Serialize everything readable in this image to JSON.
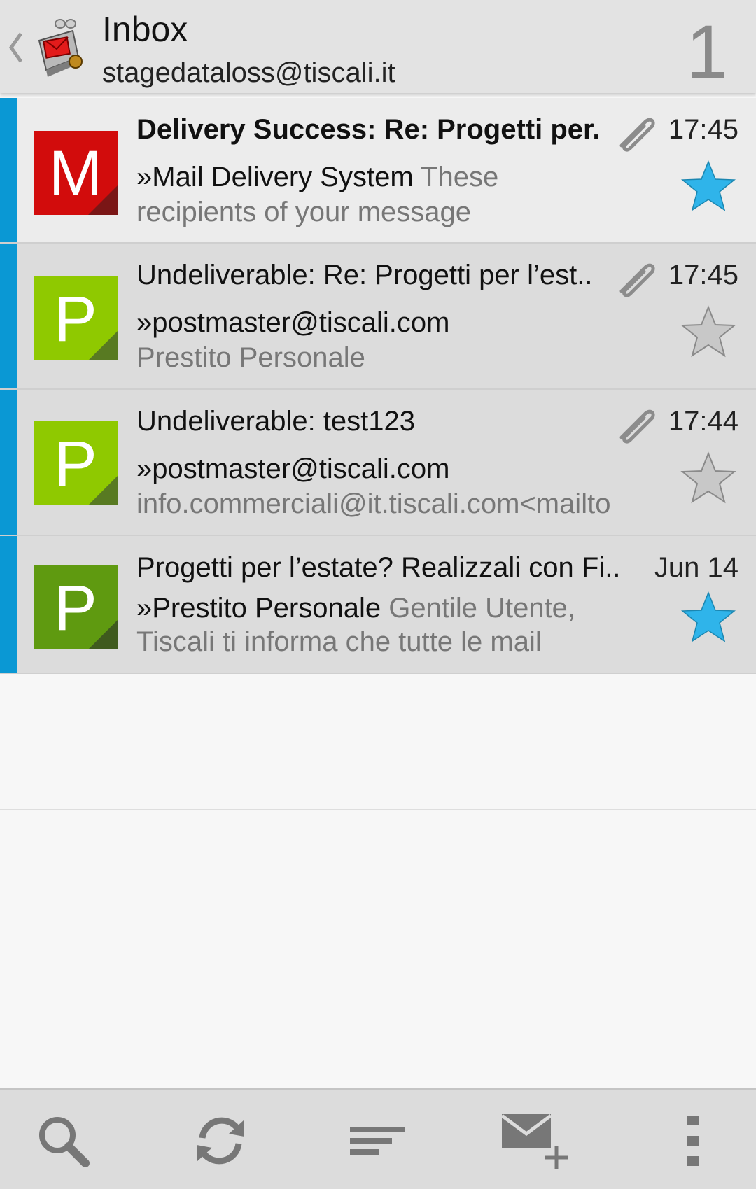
{
  "header": {
    "folder_title": "Inbox",
    "account_email": "stagedataloss@tiscali.it",
    "unread_count": "1"
  },
  "messages": [
    {
      "avatar_letter": "M",
      "avatar_color": "#d20c0c",
      "subject": "Delivery Success: Re: Progetti per..",
      "subject_bold": true,
      "sender": "»Mail Delivery System",
      "preview_1": "These",
      "preview_2": "recipients of your message",
      "time": "17:45",
      "attachment": true,
      "starred": true
    },
    {
      "avatar_letter": "P",
      "avatar_color": "#8fc900",
      "subject": "Undeliverable: Re: Progetti per l’est..",
      "subject_bold": false,
      "sender": "»postmaster@tiscali.com",
      "preview_1": "",
      "preview_2": "Prestito Personale",
      "time": "17:45",
      "attachment": true,
      "starred": false
    },
    {
      "avatar_letter": "P",
      "avatar_color": "#8fc900",
      "subject": "Undeliverable: test123",
      "subject_bold": false,
      "sender": "»postmaster@tiscali.com",
      "preview_1": "",
      "preview_2": "info.commerciali@it.tiscali.com<mailto",
      "time": "17:44",
      "attachment": true,
      "starred": false
    },
    {
      "avatar_letter": "P",
      "avatar_color": "#5f9a10",
      "subject": "Progetti per l’estate? Realizzali con Fi..",
      "subject_bold": false,
      "sender": "»Prestito Personale",
      "preview_1": "Gentile Utente,",
      "preview_2": "Tiscali ti informa che tutte le mail",
      "time": "Jun 14",
      "attachment": false,
      "starred": true
    }
  ],
  "toolbar": {
    "icons": [
      "search-icon",
      "refresh-icon",
      "sort-icon",
      "compose-icon",
      "overflow-menu-icon"
    ]
  },
  "colors": {
    "unread_bar": "#0a98d4",
    "star_active": "#2fb4ea",
    "star_inactive": "#bdbdbd"
  }
}
